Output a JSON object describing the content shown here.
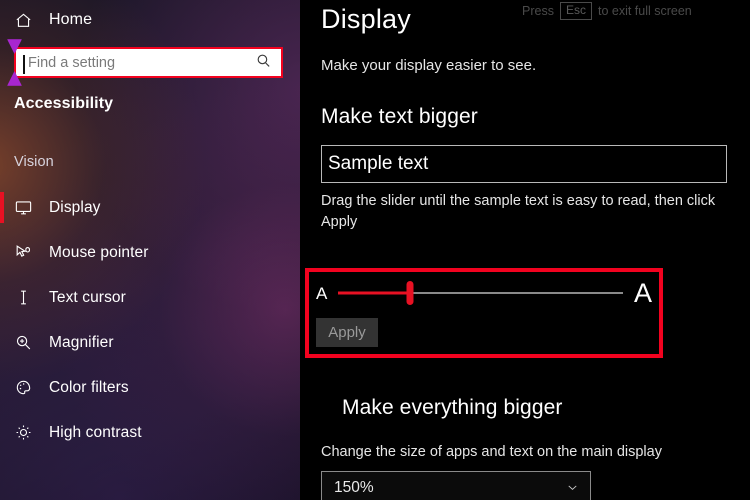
{
  "sidebar": {
    "home": {
      "label": "Home",
      "icon": "home-icon"
    },
    "search": {
      "placeholder": "Find a setting",
      "value": "",
      "icon": "search-icon"
    },
    "app_heading": "Accessibility",
    "group_heading": "Vision",
    "items": [
      {
        "label": "Display",
        "icon": "monitor-icon",
        "selected": true
      },
      {
        "label": "Mouse pointer",
        "icon": "mouse-pointer-icon",
        "selected": false
      },
      {
        "label": "Text cursor",
        "icon": "text-cursor-icon",
        "selected": false
      },
      {
        "label": "Magnifier",
        "icon": "magnifier-icon",
        "selected": false
      },
      {
        "label": "Color filters",
        "icon": "color-palette-icon",
        "selected": false
      },
      {
        "label": "High contrast",
        "icon": "brightness-icon",
        "selected": false
      }
    ]
  },
  "overlay": {
    "esc_prefix": "Press",
    "esc_key": "Esc",
    "esc_suffix": "to exit full screen"
  },
  "main": {
    "title": "Display",
    "subtitle": "Make your display easier to see.",
    "text_section": {
      "heading": "Make text bigger",
      "sample_text": "Sample text",
      "help": "Drag the slider until the sample text is easy to read, then click Apply",
      "slider": {
        "min_letter": "A",
        "max_letter": "A",
        "value_percent": 25
      },
      "apply_label": "Apply"
    },
    "scale_section": {
      "heading": "Make everything bigger",
      "help": "Change the size of apps and text on the main display",
      "selected_value": "150%",
      "chevron": "chevron-down-icon"
    }
  },
  "colors": {
    "accent_red": "#e81123",
    "highlight_red": "#f2021f",
    "selection_handle": "#a826d0",
    "main_background": "#000000"
  }
}
